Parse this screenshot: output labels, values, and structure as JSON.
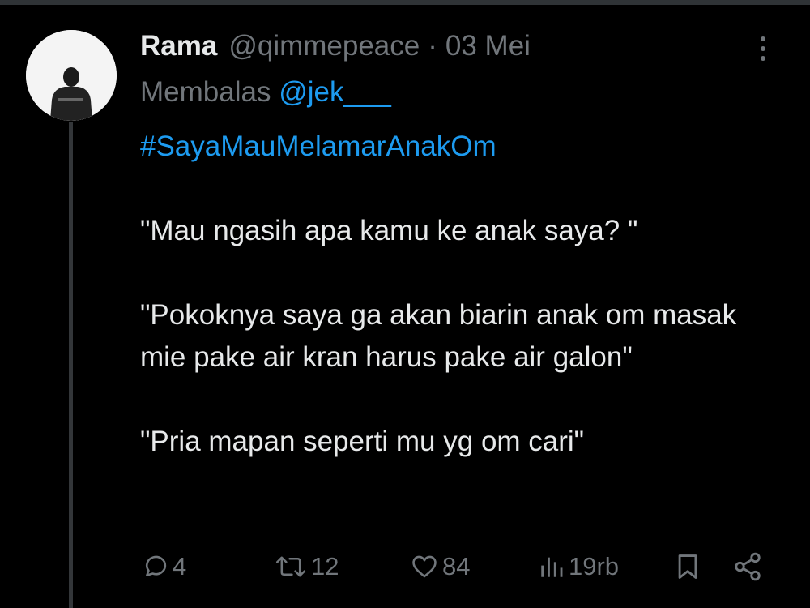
{
  "tweet": {
    "author_name": "Rama",
    "handle": "@qimmepeace",
    "separator": "·",
    "date": "03 Mei",
    "reply_prefix": "Membalas",
    "reply_mention": "@jek___",
    "hashtag": "#SayaMauMelamarAnakOm",
    "lines": [
      "\"Mau ngasih apa kamu ke anak saya? \"",
      "\"Pokoknya saya ga akan biarin anak om masak mie pake air kran harus pake air galon\"",
      "\"Pria mapan seperti mu yg om cari\""
    ]
  },
  "actions": {
    "replies": "4",
    "retweets": "12",
    "likes": "84",
    "views": "19rb"
  },
  "icons": {
    "reply": "reply-icon",
    "retweet": "retweet-icon",
    "like": "heart-icon",
    "views": "views-icon",
    "bookmark": "bookmark-icon",
    "share": "share-icon",
    "more": "more-icon"
  },
  "colors": {
    "background": "#000000",
    "text": "#e7e9ea",
    "muted": "#71767b",
    "link": "#1d9bf0"
  }
}
